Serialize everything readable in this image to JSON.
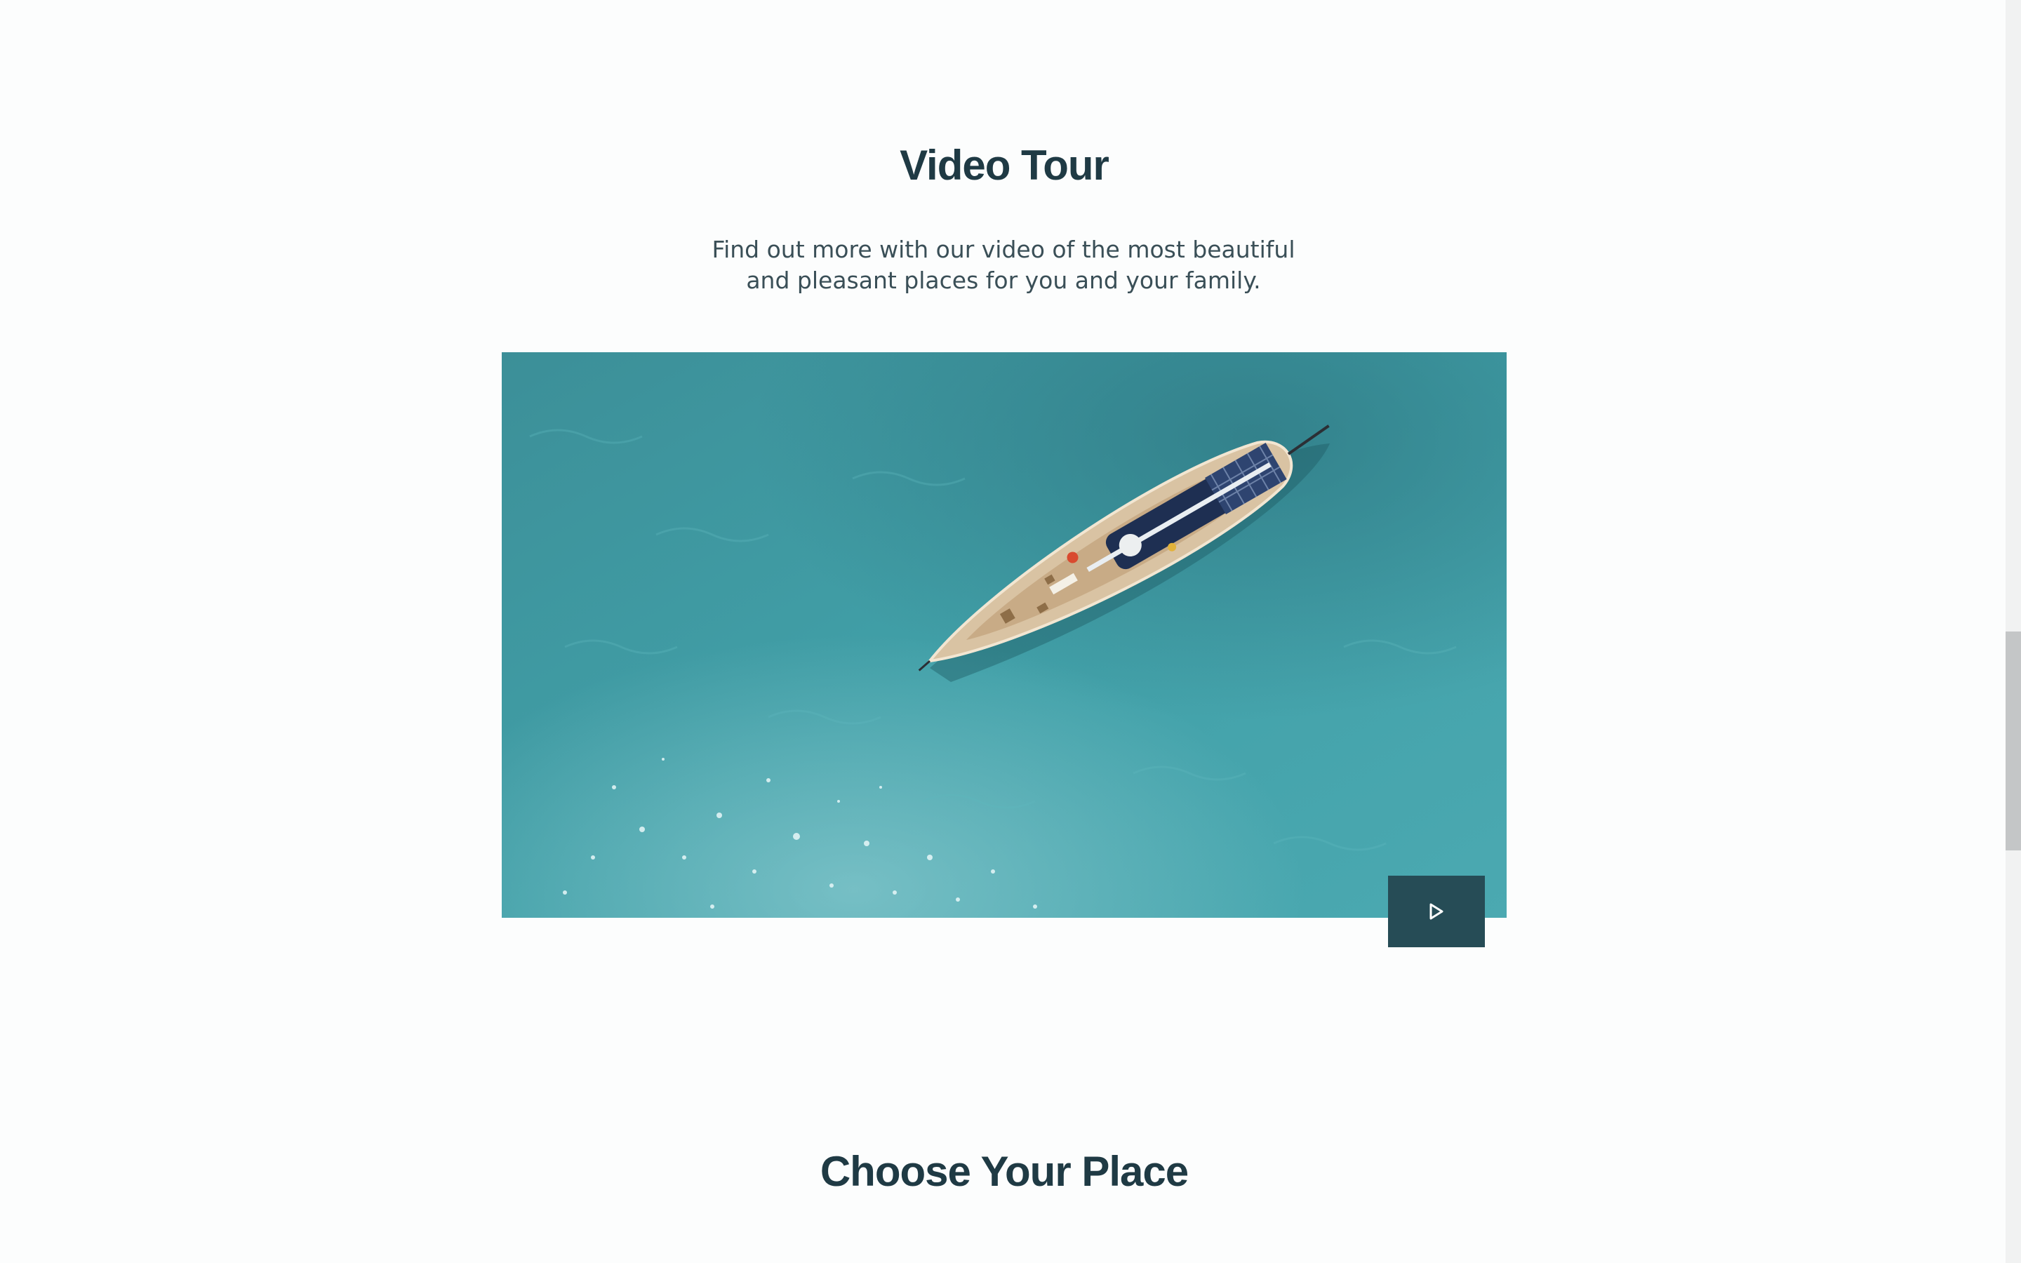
{
  "video_section": {
    "title": "Video Tour",
    "description": "Find out more with our video of the most beautiful and pleasant places for you and your family.",
    "video": {
      "subject": "aerial view of sailboat on turquoise sea",
      "play_icon": "play-icon"
    }
  },
  "places_section": {
    "title": "Choose Your Place"
  },
  "colors": {
    "heading": "#1f3a44",
    "body_text": "#3a4f57",
    "play_button_bg": "#264c56",
    "water": "#3f9aa3",
    "page_bg": "#fcfdfd"
  }
}
